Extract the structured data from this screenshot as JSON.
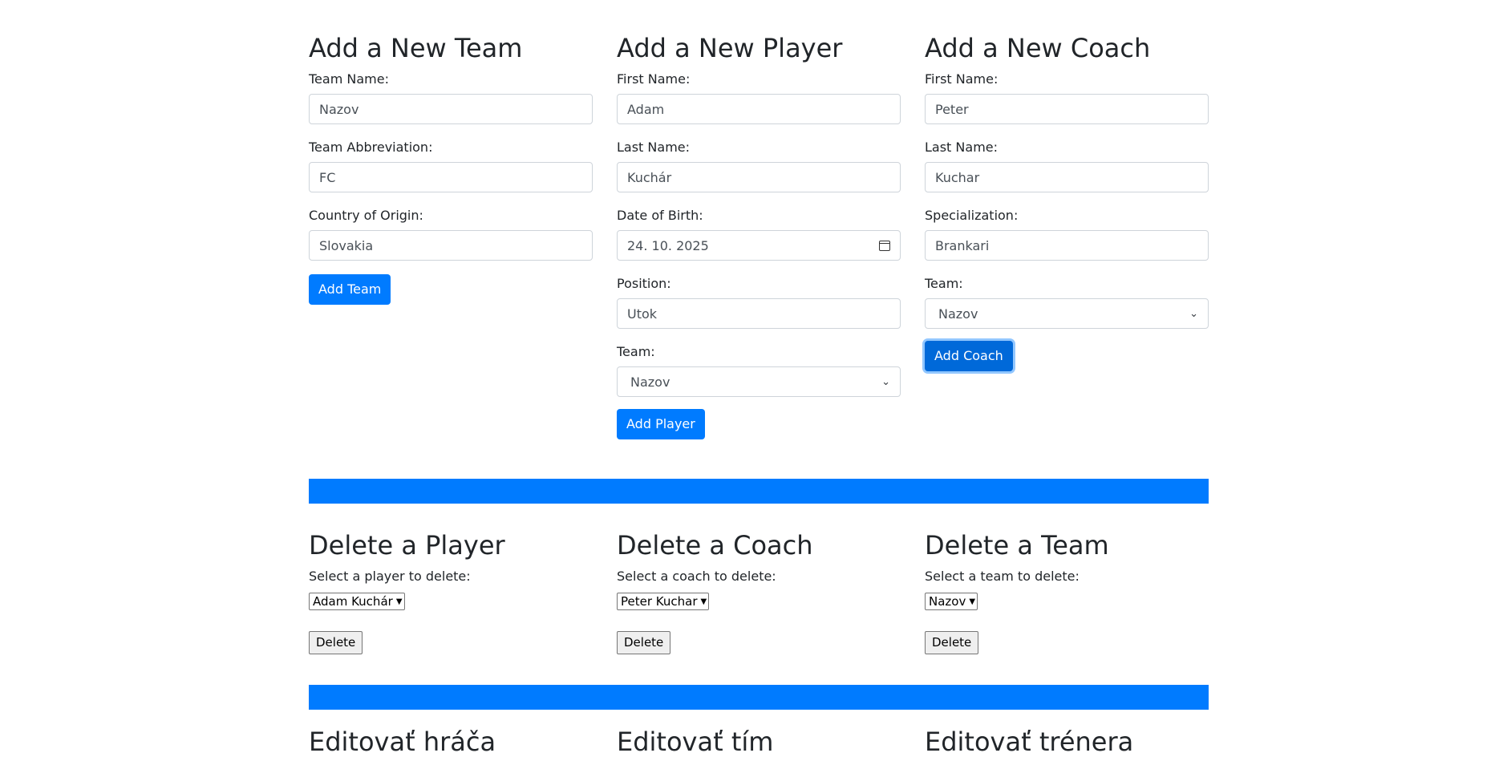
{
  "add_team": {
    "title": "Add a New Team",
    "name_label": "Team Name:",
    "name_value": "Nazov",
    "abbr_label": "Team Abbreviation:",
    "abbr_value": "FC",
    "country_label": "Country of Origin:",
    "country_value": "Slovakia",
    "submit_label": "Add Team"
  },
  "add_player": {
    "title": "Add a New Player",
    "first_name_label": "First Name:",
    "first_name_value": "Adam",
    "last_name_label": "Last Name:",
    "last_name_value": "Kuchár",
    "dob_label": "Date of Birth:",
    "dob_value": "24. 10. 2025",
    "position_label": "Position:",
    "position_value": "Utok",
    "team_label": "Team:",
    "team_value": "Nazov",
    "submit_label": "Add Player"
  },
  "add_coach": {
    "title": "Add a New Coach",
    "first_name_label": "First Name:",
    "first_name_value": "Peter",
    "last_name_label": "Last Name:",
    "last_name_value": "Kuchar",
    "spec_label": "Specialization:",
    "spec_value": "Brankari",
    "team_label": "Team:",
    "team_value": "Nazov",
    "submit_label": "Add Coach"
  },
  "delete_player": {
    "title": "Delete a Player",
    "select_label": "Select a player to delete:",
    "selected": "Adam Kuchár",
    "button_label": "Delete"
  },
  "delete_coach": {
    "title": "Delete a Coach",
    "select_label": "Select a coach to delete:",
    "selected": "Peter Kuchar",
    "button_label": "Delete"
  },
  "delete_team": {
    "title": "Delete a Team",
    "select_label": "Select a team to delete:",
    "selected": "Nazov",
    "button_label": "Delete"
  },
  "edit": {
    "player_title": "Editovať hráča",
    "team_title": "Editovať tím",
    "coach_title": "Editovať trénera"
  },
  "colors": {
    "primary": "#007bff",
    "text": "#212529"
  }
}
